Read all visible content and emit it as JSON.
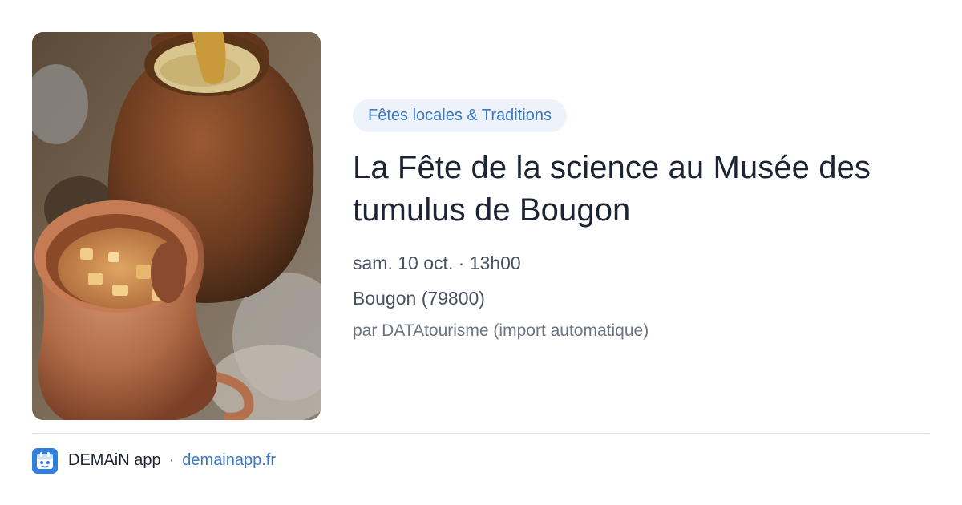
{
  "event": {
    "category": "Fêtes locales & Traditions",
    "title": "La Fête de la science au Musée des tumulus de Bougon",
    "datetime": "sam. 10 oct. · 13h00",
    "location": "Bougon (79800)",
    "source": "par DATAtourisme (import automatique)",
    "image_icon": "clay-pots-photo"
  },
  "footer": {
    "app_name": "DEMAiN app",
    "separator": "·",
    "link": "demainapp.fr",
    "logo_icon": "demain-app-logo-icon"
  },
  "colors": {
    "accent": "#3b78c4",
    "pill_bg": "#eef3fb",
    "title": "#1c2333",
    "muted": "#4a5261",
    "divider": "#dde3ea",
    "logo": "#2f7fe0"
  }
}
